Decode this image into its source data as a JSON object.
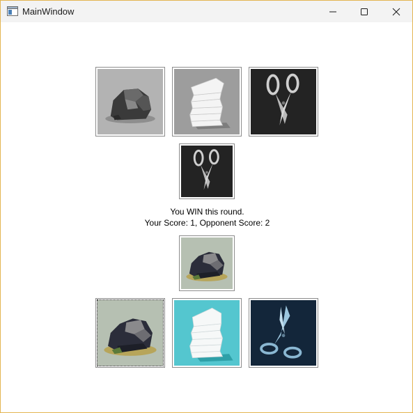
{
  "window": {
    "title": "MainWindow",
    "border_color": "#e3b550"
  },
  "opponent": {
    "choices": [
      {
        "icon": "rock-gray-icon"
      },
      {
        "icon": "paper-gray-icon"
      },
      {
        "icon": "scissors-dark-icon"
      }
    ],
    "selected": {
      "icon": "scissors-dark-icon"
    }
  },
  "result": {
    "line1": "You WIN this round.",
    "line2": "Your Score: 1, Opponent Score: 2"
  },
  "player": {
    "selected": {
      "icon": "rock-color-icon"
    },
    "choices": [
      {
        "icon": "rock-color-icon",
        "focused": true
      },
      {
        "icon": "paper-color-icon"
      },
      {
        "icon": "scissors-color-icon"
      }
    ]
  }
}
